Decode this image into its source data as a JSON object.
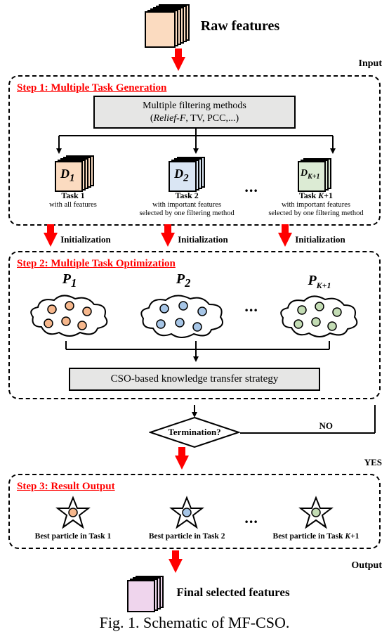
{
  "top": {
    "raw_features": "Raw features",
    "input_label": "Input"
  },
  "step1": {
    "title": "Step 1: Multiple Task Generation",
    "filter_line1": "Multiple filtering methods",
    "filter_line2": "(Relief-F, TV, PCC,...)",
    "tasks": [
      {
        "d": "D",
        "sub": "1",
        "title": "Task 1",
        "desc": "with all features"
      },
      {
        "d": "D",
        "sub": "2",
        "title": "Task 2",
        "desc": "with important features\nselected by one filtering method"
      },
      {
        "d": "D",
        "sub": "K+1",
        "title": "Task K+1",
        "desc": "with important features\nselected by one filtering method"
      }
    ],
    "dots": "..."
  },
  "init": {
    "label": "Initialization"
  },
  "step2": {
    "title": "Step 2: Multiple Task Optimization",
    "pops": [
      {
        "p": "P",
        "sub": "1"
      },
      {
        "p": "P",
        "sub": "2"
      },
      {
        "p": "P",
        "sub": "K+1"
      }
    ],
    "dots": "...",
    "kbox": "CSO-based knowledge transfer strategy"
  },
  "decision": {
    "text": "Termination?",
    "yes": "YES",
    "no": "NO"
  },
  "step3": {
    "title": "Step 3: Result Output",
    "stars": [
      {
        "label": "Best particle in Task 1"
      },
      {
        "label": "Best particle in Task 2"
      },
      {
        "label": "Best particle in Task K+1"
      }
    ],
    "dots": "..."
  },
  "output": {
    "label": "Output",
    "final": "Final selected features"
  },
  "caption": "Fig. 1. Schematic of MF-CSO."
}
